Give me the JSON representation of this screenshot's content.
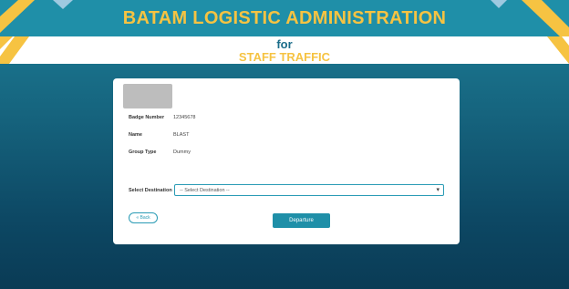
{
  "header": {
    "title": "BATAM LOGISTIC ADMINISTRATION",
    "for": "for",
    "subtitle": "STAFF TRAFFIC"
  },
  "profile": {
    "fields": [
      {
        "label": "Badge Number",
        "value": "12345678"
      },
      {
        "label": "Name",
        "value": "BLAST"
      },
      {
        "label": "Group Type",
        "value": "Dummy"
      }
    ]
  },
  "destination": {
    "label": "Select Destination",
    "selected": "-- Select Destination --"
  },
  "buttons": {
    "back": "« Back",
    "departure": "Departure"
  },
  "colors": {
    "teal": "#1f8fa8",
    "gold": "#f6c342",
    "navy": "#0a3b55"
  },
  "icons": {
    "dropdown": "chevron-down-icon"
  }
}
